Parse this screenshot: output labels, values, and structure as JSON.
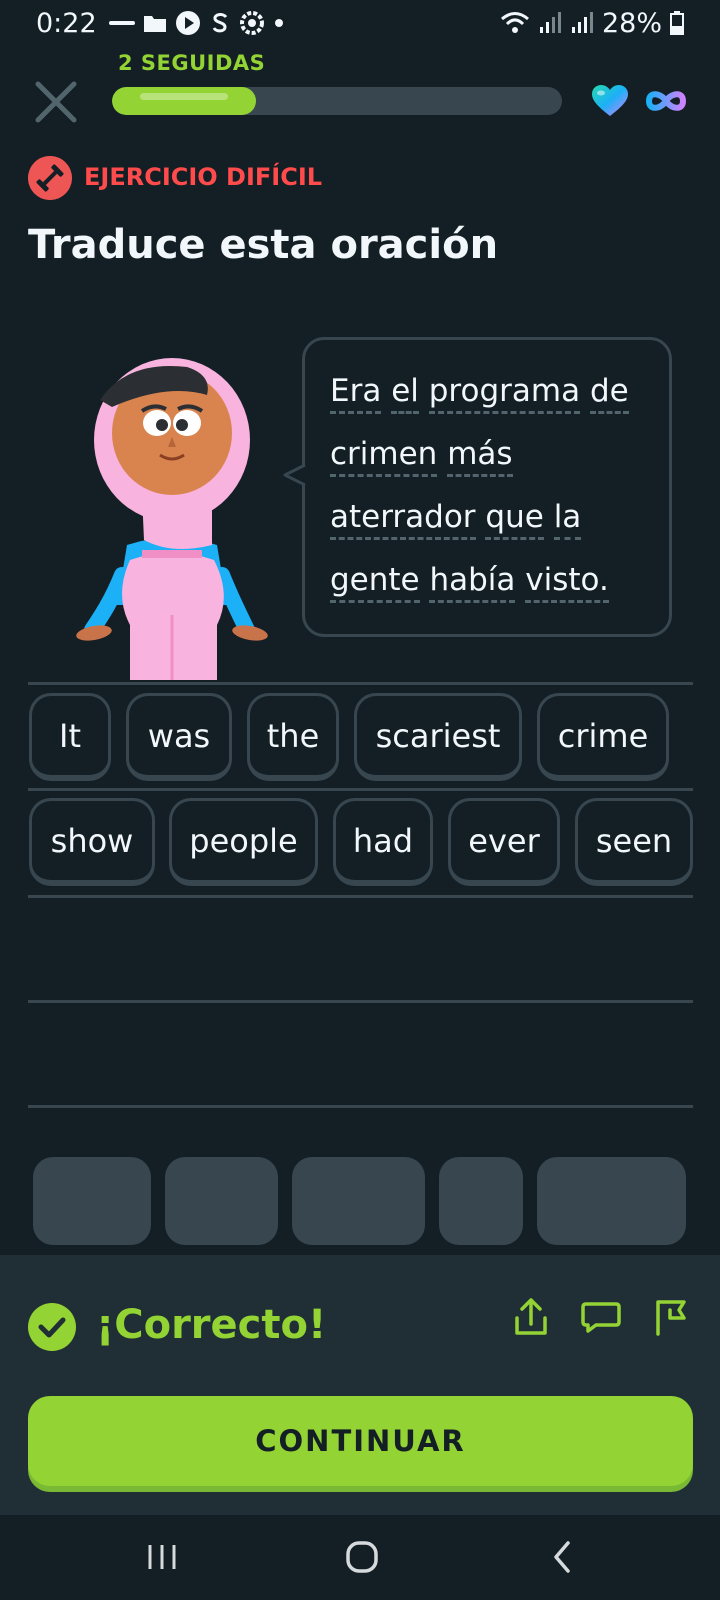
{
  "status_bar": {
    "time": "0:22",
    "battery": "28%",
    "icons": [
      "coursera-icon",
      "folder-icon",
      "play-icon",
      "s-app-icon",
      "vpn-gear-icon",
      "dot-icon"
    ],
    "right_icons": [
      "wifi-icon",
      "signal-icon",
      "signal-icon",
      "battery-icon"
    ]
  },
  "header": {
    "streak_label": "2 SEGUIDAS",
    "progress": 0.32,
    "hearts": "infinite"
  },
  "exercise": {
    "badge_label": "EJERCICIO DIFÍCIL",
    "title": "Traduce esta oración",
    "sentence_lines": [
      [
        "Era",
        "el",
        "programa",
        "de"
      ],
      [
        "crimen",
        "más"
      ],
      [
        "aterrador",
        "que",
        "la"
      ],
      [
        "gente",
        "había",
        "visto."
      ]
    ]
  },
  "answer_words": [
    "It",
    "was",
    "the",
    "scariest",
    "crime",
    "show",
    "people",
    "had",
    "ever",
    "seen"
  ],
  "word_bank_slot_count": 5,
  "feedback": {
    "title": "¡Correcto!",
    "icons": [
      "share-icon",
      "comment-icon",
      "report-flag-icon"
    ]
  },
  "continue_label": "CONTINUAR",
  "colors": {
    "background": "#131f24",
    "accent_green": "#93d333",
    "hard_red": "#ff4b4b",
    "border": "#37464f",
    "panel": "#202f36"
  }
}
